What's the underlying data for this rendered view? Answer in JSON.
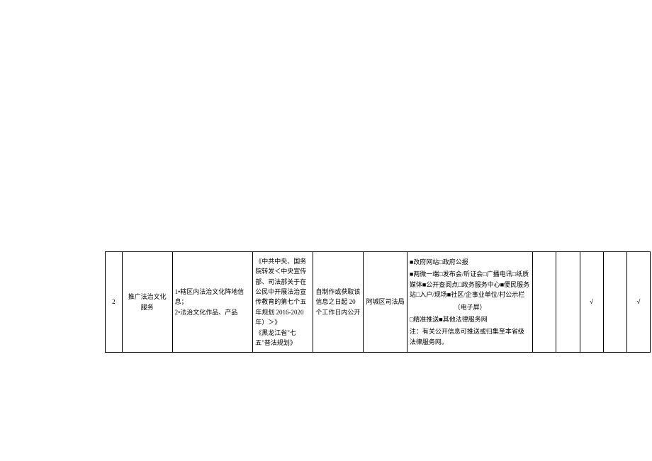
{
  "row": {
    "num": "2",
    "title_line1": "推广法治文化",
    "title_line2": "服务",
    "content": "1•辖区内法治文化阵地信息；\n2•法治文化作品、产品",
    "basis": "《中共中央、国务院转发＜中央宣传部、司法部关于在公民中开展法治宣传教育的第七个五年规划 2016-2020年）＞》\n《黑龙江省\"七五\"普法规划》",
    "time": "自制作或获取该信息之日起 20 个工作日内公开",
    "subject": "阿城区司法局",
    "channel_l1": "■改府网站□政府公报",
    "channel_l2": "■两微一端□发布会/听证会□广播电讯□纸质媒体■公开查阅点□政务服务中心■便民服务站□入户/现场■社区/企事业单位/村公示栏",
    "channel_l3": "（电子屏）",
    "channel_l4": "□精准推送■其他法律服务网",
    "channel_note": "注：有关公开信息可推送或归集至本省级法律服务网。",
    "col_a": "",
    "col_b": "",
    "col_c": "√",
    "col_d": "",
    "col_e": "√"
  }
}
